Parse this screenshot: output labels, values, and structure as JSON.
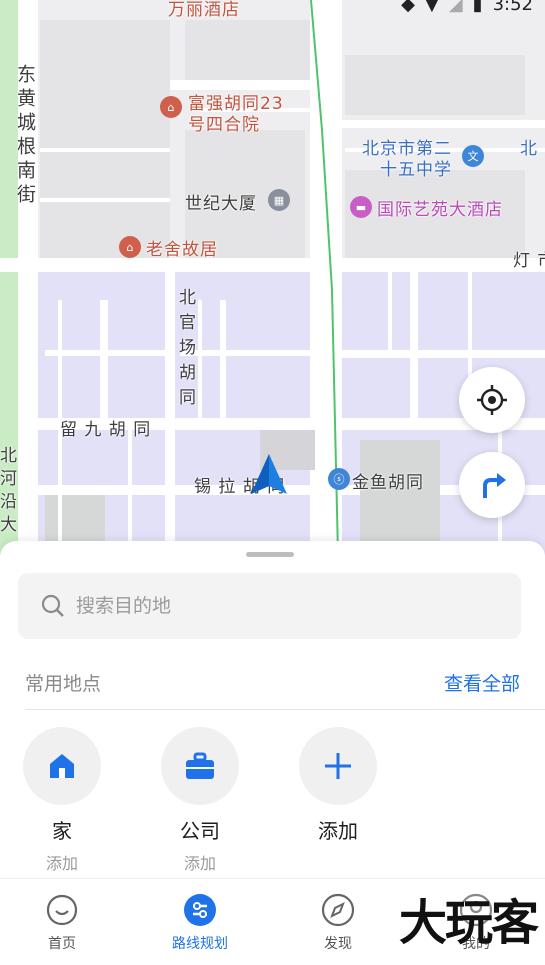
{
  "status_bar": {
    "time": "3:52"
  },
  "map": {
    "labels": {
      "hotel_top": "万丽酒店",
      "donghuangcheng": "东黄城根南街",
      "fuqiang": "富强胡同23",
      "fuqiang2": "号四合院",
      "school1": "北京市第二",
      "school2": "十五中学",
      "edge_north": "北",
      "world_building": "世纪大厦",
      "intl_hotel": "国际艺苑大酒店",
      "laoshe": "老舍故居",
      "deng": "灯 市",
      "beiguanchang": "北官场胡同",
      "jiujiu": "留 九 胡 同",
      "xila": "锡 拉 胡 同",
      "jinyu": "金鱼胡同",
      "left_edge": "北河沿大"
    }
  },
  "sheet": {
    "search_placeholder": "搜索目的地",
    "section_title": "常用地点",
    "see_all": "查看全部",
    "places": [
      {
        "name": "家",
        "sub": "添加",
        "icon": "home-icon"
      },
      {
        "name": "公司",
        "sub": "添加",
        "icon": "briefcase-icon"
      },
      {
        "name": "添加",
        "sub": "",
        "icon": "plus-icon"
      }
    ]
  },
  "tabs": [
    {
      "label": "首页",
      "icon": "home-face-icon",
      "active": false
    },
    {
      "label": "路线规划",
      "icon": "route-icon",
      "active": true
    },
    {
      "label": "发现",
      "icon": "compass-icon",
      "active": false
    },
    {
      "label": "我的",
      "icon": "profile-icon",
      "active": false
    }
  ],
  "watermark": "大玩客",
  "colors": {
    "accent": "#1f72e8",
    "map_purple": "#e3e1f7",
    "park_green": "#c9ecc4"
  }
}
